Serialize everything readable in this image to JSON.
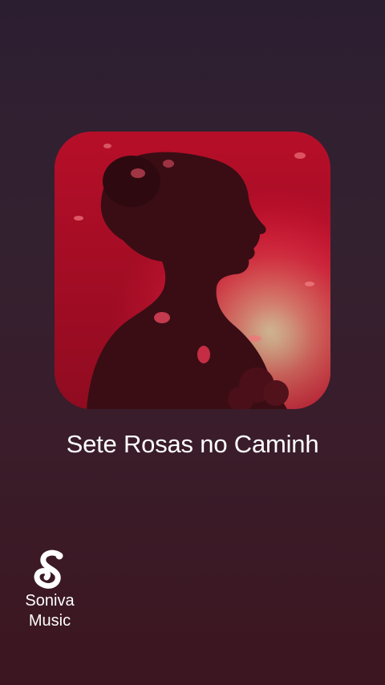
{
  "song": {
    "title": "Sete Rosas no Caminh"
  },
  "brand": {
    "line1": "Soniva",
    "line2": "Music",
    "logo_icon": "soniva-s-music-note-icon"
  },
  "colors": {
    "background_top": "#2c1e31",
    "background_bottom": "#3c1620",
    "cover_red": "#e8183b",
    "cover_glow": "#ffd2a0",
    "text": "#ffffff"
  }
}
